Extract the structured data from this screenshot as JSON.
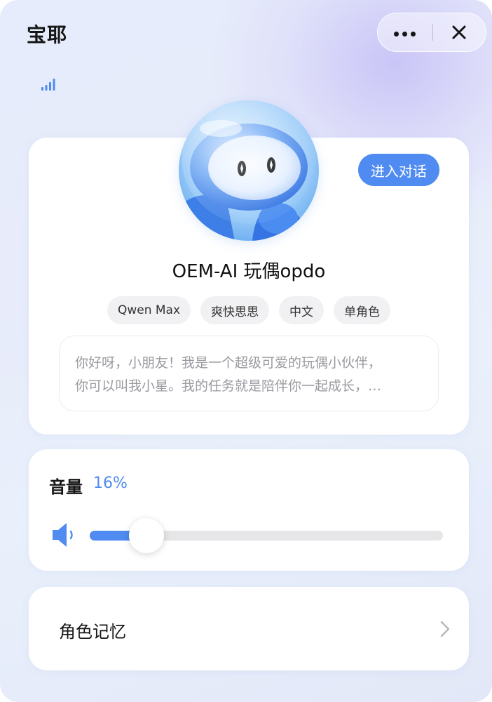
{
  "app": {
    "title": "宝耶"
  },
  "capsule": {
    "more_icon": "more-dots-icon",
    "close_icon": "close-icon"
  },
  "status": {
    "signal_icon": "signal-bars-icon"
  },
  "profile": {
    "avatar_icon": "robot-avatar",
    "enter_label": "进入对话",
    "name": "OEM-AI 玩偶opdo",
    "tags": [
      "Qwen Max",
      "爽快思思",
      "中文",
      "单角色"
    ],
    "intro_lines": [
      "你好呀，小朋友！我是一个超级可爱的玩偶小伙伴，",
      "你可以叫我小星。我的任务就是陪伴你一起成长，…"
    ]
  },
  "volume": {
    "label": "音量",
    "value_text": "16%",
    "level": 0.16,
    "speaker_icon": "speaker-icon"
  },
  "memory": {
    "label": "角色记忆",
    "chevron_icon": "chevron-right-icon"
  },
  "colors": {
    "accent": "#4f8bf0",
    "track": "#e6e6e8",
    "card": "#ffffff"
  }
}
